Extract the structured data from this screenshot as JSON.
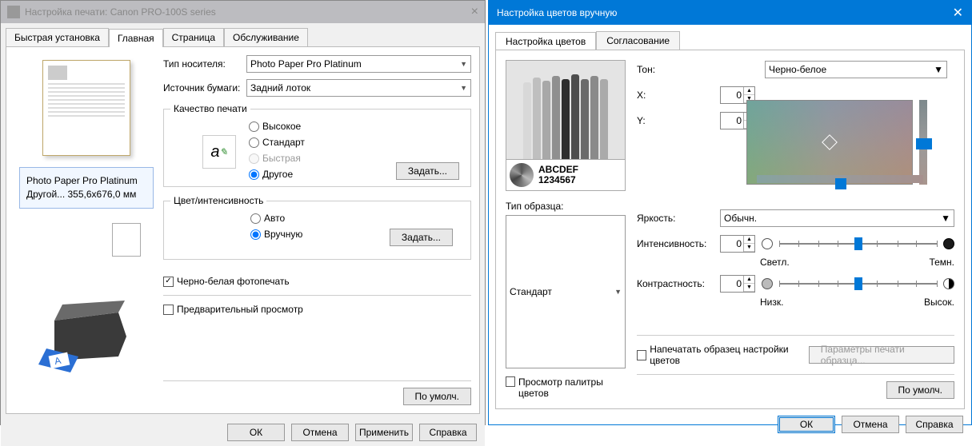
{
  "left": {
    "title": "Настройка печати: Canon PRO-100S series",
    "tabs": [
      "Быстрая установка",
      "Главная",
      "Страница",
      "Обслуживание"
    ],
    "active_tab": 1,
    "media_label": "Тип носителя:",
    "media_value": "Photo Paper Pro Platinum",
    "source_label": "Источник бумаги:",
    "source_value": "Задний лоток",
    "quality_legend": "Качество печати",
    "quality_options": {
      "high": "Высокое",
      "standard": "Стандарт",
      "fast": "Быстрая",
      "other": "Другое"
    },
    "quality_set_btn": "Задать...",
    "color_legend": "Цвет/интенсивность",
    "color_options": {
      "auto": "Авто",
      "manual": "Вручную"
    },
    "color_set_btn": "Задать...",
    "bw_label": "Черно-белая фотопечать",
    "preview_chk_label": "Предварительный просмотр",
    "preview_info_line1": "Photo Paper Pro Platinum",
    "preview_info_line2": "Другой... 355,6x676,0 мм",
    "defaults_btn": "По умолч.",
    "buttons": {
      "ok": "ОК",
      "cancel": "Отмена",
      "apply": "Применить",
      "help": "Справка"
    }
  },
  "right": {
    "title": "Настройка цветов вручную",
    "tabs": [
      "Настройка цветов",
      "Согласование"
    ],
    "active_tab": 0,
    "sample_alpha": "ABCDEF",
    "sample_num": "1234567",
    "sample_type_label": "Тип образца:",
    "sample_type_value": "Стандарт",
    "palette_chk_label": "Просмотр палитры цветов",
    "tone_label": "Тон:",
    "tone_value": "Черно-белое",
    "x_label": "X:",
    "x_value": "0",
    "y_label": "Y:",
    "y_value": "0",
    "brightness_label": "Яркость:",
    "brightness_value": "Обычн.",
    "intensity_label": "Интенсивность:",
    "intensity_value": "0",
    "intensity_left": "Светл.",
    "intensity_right": "Темн.",
    "contrast_label": "Контрастность:",
    "contrast_value": "0",
    "contrast_left": "Низк.",
    "contrast_right": "Высок.",
    "print_sample_label": "Напечатать образец настройки цветов",
    "print_sample_btn": "Параметры печати образца...",
    "defaults_btn": "По умолч.",
    "buttons": {
      "ok": "ОК",
      "cancel": "Отмена",
      "help": "Справка"
    }
  }
}
